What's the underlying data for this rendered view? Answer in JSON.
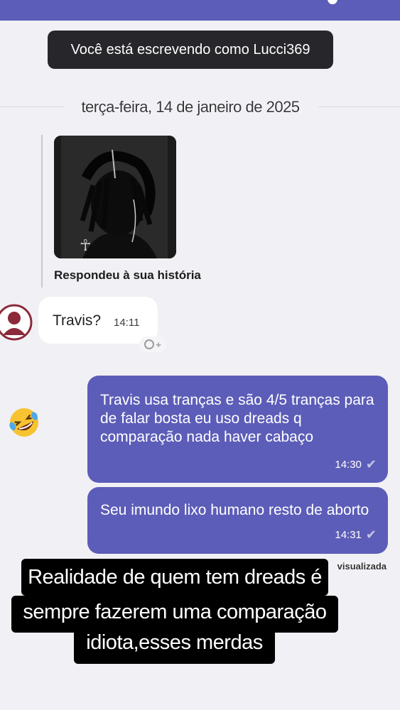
{
  "banner": {
    "writing_as": "Você está escrevendo como Lucci369"
  },
  "chat": {
    "date_divider": "terça-feira, 14 de janeiro de 2025",
    "story_reply": {
      "label": "Respondeu à sua história"
    },
    "incoming": {
      "text": "Travis?",
      "time": "14:11"
    },
    "outgoing": [
      {
        "text": "Travis usa tranças e são 4/5 tranças para de falar bosta eu uso dreads q comparação nada haver cabaço",
        "time": "14:30"
      },
      {
        "text": "Seu imundo lixo humano resto de aborto",
        "time": "14:31"
      }
    ],
    "seen_status": "visualizada",
    "reaction_emoji": "🤣"
  },
  "caption": {
    "line1": "Realidade de quem tem dreads é",
    "line2": "sempre fazerem uma comparação",
    "line3": "idiota,esses merdas"
  },
  "colors": {
    "accent": "#5c5db8",
    "background": "#f1f0f5",
    "banner": "#27272b"
  },
  "icons": [
    "avatar-placeholder-icon",
    "add-reaction-icon",
    "read-check-icon"
  ]
}
